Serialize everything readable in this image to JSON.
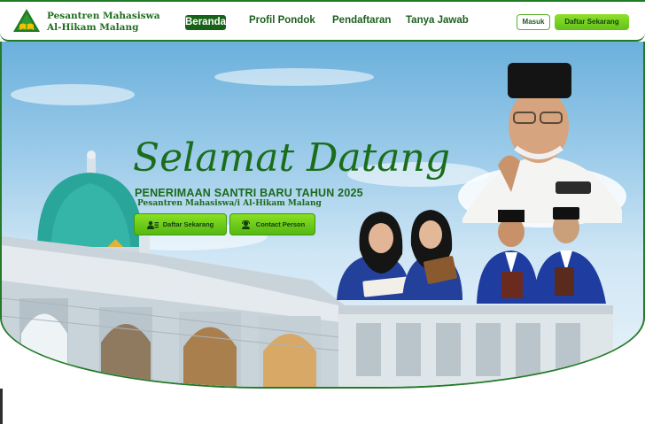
{
  "brand": {
    "line1": "Pesantren Mahasiswa",
    "line2": "Al-Hikam Malang"
  },
  "nav": {
    "active": "Beranda",
    "items": [
      "Profil Pondok",
      "Pendaftaran",
      "Tanya Jawab"
    ]
  },
  "header_actions": {
    "login": "Masuk",
    "register": "Daftar Sekarang"
  },
  "hero": {
    "title": "Selamat Datang",
    "subtitle": "PENERIMAAN SANTRI BARU TAHUN 2025",
    "tagline": "Pesantren Mahasiswa/i Al-Hikam Malang",
    "cta_primary": "Daftar Sekarang",
    "cta_secondary": "Contact Person"
  },
  "colors": {
    "brand_green": "#1b6d1b",
    "accent_lime": "#7ad61f",
    "sky": "#9fcdea"
  },
  "icons": {
    "logo": "mosque-book-logo",
    "cta_primary": "users-icon",
    "cta_secondary": "headset-icon"
  }
}
